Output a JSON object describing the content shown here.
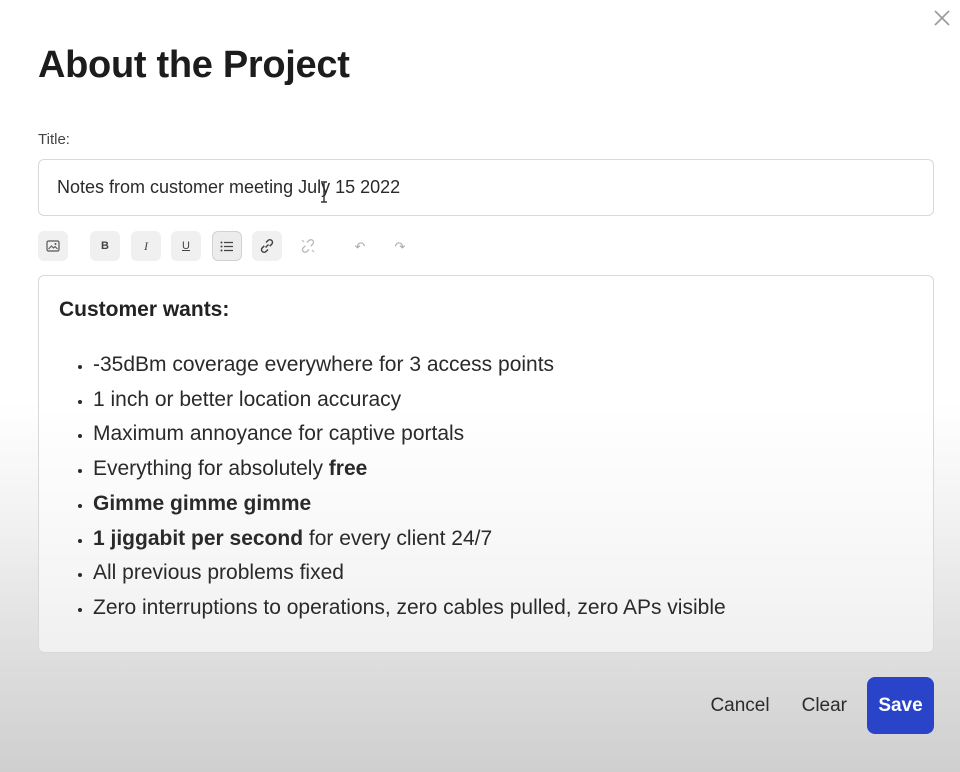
{
  "dialog": {
    "title": "About the Project"
  },
  "form": {
    "title_label": "Title:",
    "title_value": "Notes from customer meeting July 15 2022"
  },
  "toolbar": {
    "bold_label": "B",
    "italic_label": "I",
    "underline_label": "U",
    "undo_label": "↶",
    "redo_label": "↷"
  },
  "editor": {
    "heading": "Customer wants:",
    "items": [
      {
        "text": "-35dBm coverage everywhere for 3 access points"
      },
      {
        "text": "1 inch or better location accuracy"
      },
      {
        "text": "Maximum annoyance for captive portals"
      },
      {
        "text": "Everything for absolutely ",
        "bold": "free"
      },
      {
        "bold": "Gimme gimme gimme"
      },
      {
        "bold": "1 jiggabit per second",
        "text": " for every client 24/7"
      },
      {
        "text": "All previous problems fixed"
      },
      {
        "text": "Zero interruptions to operations, zero cables pulled, zero APs visible"
      }
    ]
  },
  "actions": {
    "cancel_label": "Cancel",
    "clear_label": "Clear",
    "save_label": "Save"
  },
  "colors": {
    "primary": "#2a44c9"
  }
}
